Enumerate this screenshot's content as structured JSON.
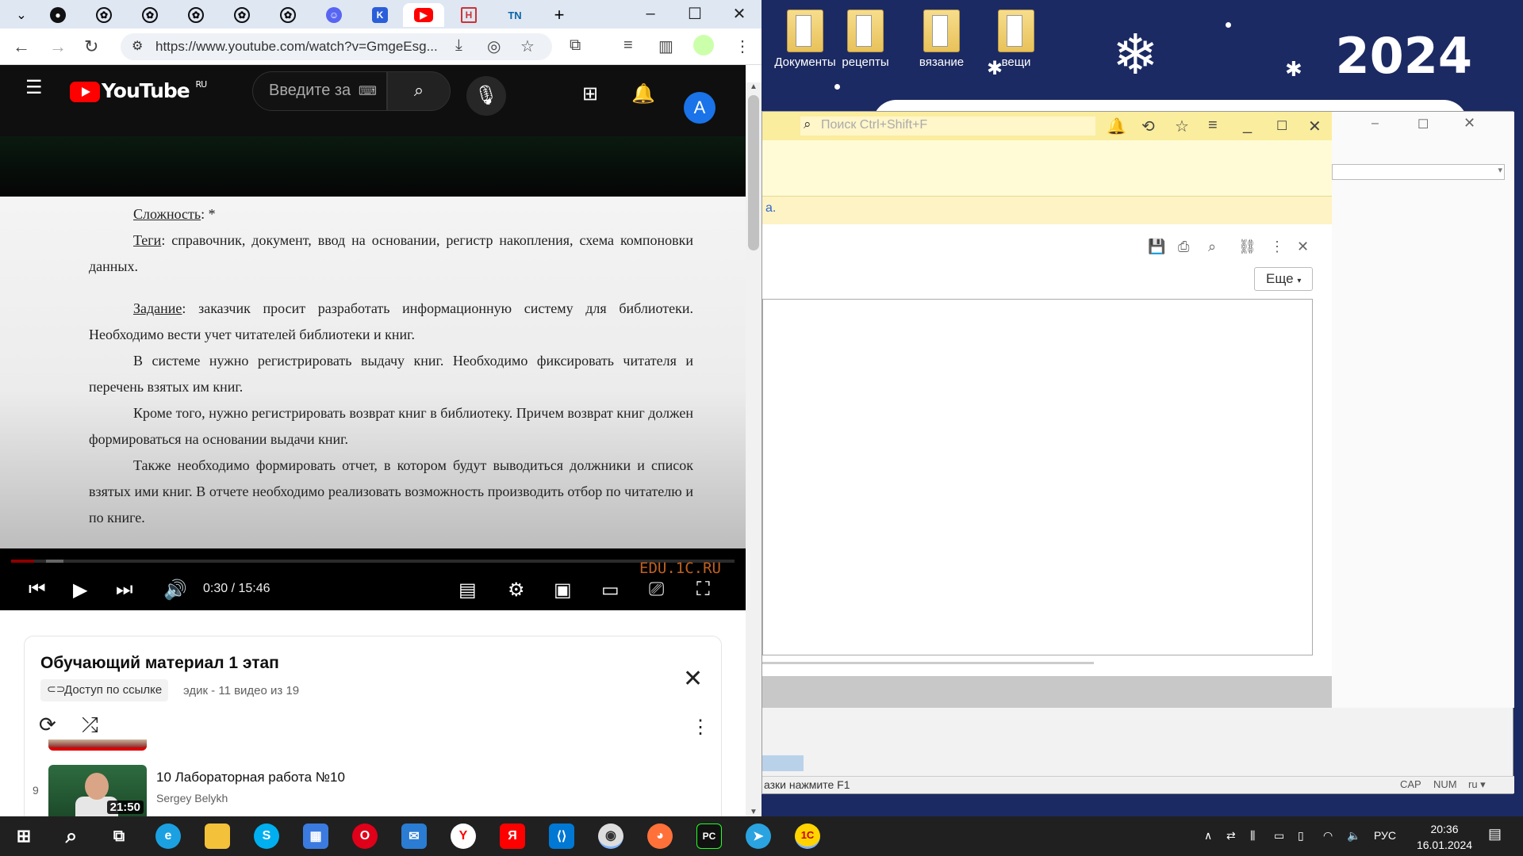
{
  "desktop": {
    "icons": [
      {
        "label": "Документы"
      },
      {
        "label": "рецепты"
      },
      {
        "label": "вязание"
      },
      {
        "label": "вещи"
      }
    ],
    "year": "2024"
  },
  "browser": {
    "url": "https://www.youtube.com/watch?v=GmgeEsg...",
    "tabs": [
      "github",
      "openai",
      "openai",
      "openai",
      "openai",
      "openai",
      "discord",
      "kinopoisk",
      "youtube",
      "habr",
      "tn"
    ]
  },
  "youtube": {
    "logo_text": "YouTube",
    "region": "RU",
    "search_placeholder": "Введите за",
    "avatar_letter": "A",
    "video": {
      "lines": [
        {
          "label": "Сложность",
          "text": ": *"
        },
        {
          "label": "Теги",
          "text": ": справочник, документ, ввод на основании, регистр накопления, схема компоновки данных."
        },
        {
          "label": "Задание",
          "text": ": заказчик просит разработать информационную систему для библиотеки. Необходимо вести учет читателей библиотеки и книг."
        },
        {
          "label": "",
          "text": "В системе нужно регистрировать выдачу книг. Необходимо фиксировать читателя и перечень взятых им книг."
        },
        {
          "label": "",
          "text": "Кроме того, нужно регистрировать возврат книг в библиотеку. Причем возврат книг должен формироваться на основании выдачи книг."
        },
        {
          "label": "",
          "text": "Также необходимо формировать отчет, в котором будут выводиться должники и список взятых ими книг. В отчете необходимо реализовать возможность производить отбор по читателю и по книге."
        }
      ],
      "time": "0:30 / 15:46",
      "progress": 0.032,
      "watermark": "EDU.1C.RU"
    },
    "playlist": {
      "title": "Обучающий материал 1 этап",
      "access": "Доступ по ссылке",
      "meta": "эдик - 11 видео из 19",
      "item": {
        "index": "9",
        "title": "10 Лабораторная работа №10",
        "author": "Sergey Belykh",
        "duration": "21:50"
      }
    }
  },
  "onec": {
    "search_placeholder": "Поиск Ctrl+Shift+F",
    "link_fragment": "а.",
    "more_button": "Еще",
    "status_text": "азки нажмите F1",
    "indicators": [
      "CAP",
      "NUM",
      "ru"
    ]
  },
  "taskbar": {
    "lang": "РУС",
    "time": "20:36",
    "date": "16.01.2024"
  },
  "colors": {
    "youtube_red": "#ff0000",
    "onec_yellow": "#fbed9e",
    "taskbar": "#202020",
    "desktop": "#1c2a63"
  }
}
